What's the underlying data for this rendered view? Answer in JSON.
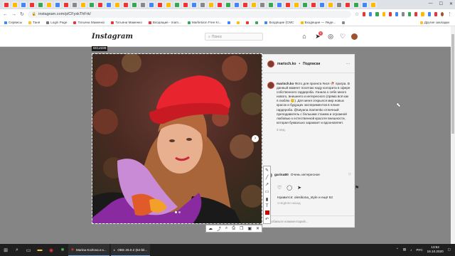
{
  "browser": {
    "url": "instagram.com/p/CFyxkThFrk/",
    "bookmarks": [
      "Сервисы",
      "Таня",
      "Login Page",
      "Татьяна Маменко",
      "Татьяна Маменко",
      "Входящие - mam...",
      "Marketoon Free Ki...",
      "",
      "",
      "",
      "Входящие (CMC",
      "Входящие — Янде...",
      "",
      "Другие закладки"
    ],
    "window_controls": [
      "—",
      "☐",
      "✕"
    ]
  },
  "instagram": {
    "logo": "Instagram",
    "search_placeholder": "Поиск",
    "nav_icons": [
      "home-icon",
      "direct-icon",
      "explore-icon",
      "activity-icon",
      "profile-icon"
    ],
    "notification_count": "2"
  },
  "photo": {
    "size_label": "601x599"
  },
  "post": {
    "author": "marisch.ko",
    "separator": "•",
    "follow_label": "Подписки",
    "more": "···",
    "caption_author": "marisch.ko",
    "caption_text": "Фото для проекта #ися 🥀 лрагра. В данный момент посетаю наду колорита в сфере собственного гардероба. Узнала о себе много нового, внешнего и интересного (прямо всё как я люблю 😊). Для меня открылся мир новых красок и будущих экспериментов в плане гардероба. @tatyana.mamenko отличный преподаватель с большим стажем и огромной любовью к естественной красоте внешности, которая буквально заражает и вдохновляет.",
    "caption_time": "3 нед.",
    "comment_author": "garina80",
    "comment_text": "Очень интересное",
    "likes_text": "Нравится: olesikona_style и ещё 53",
    "date": "3 НЕДЕЛИ НАЗАД",
    "add_comment_placeholder": "Добавьте комментарий..."
  },
  "taskbar": {
    "apps": [
      "Marina Kozlova и к...",
      "OBS 26.0.2 (64-bit..."
    ],
    "language": "РУС",
    "time": "13:52",
    "date": "16.10.2020"
  },
  "colors": {
    "hat": "#e8242e",
    "overlay": "#000000",
    "taskbar": "#1f1f1f"
  }
}
